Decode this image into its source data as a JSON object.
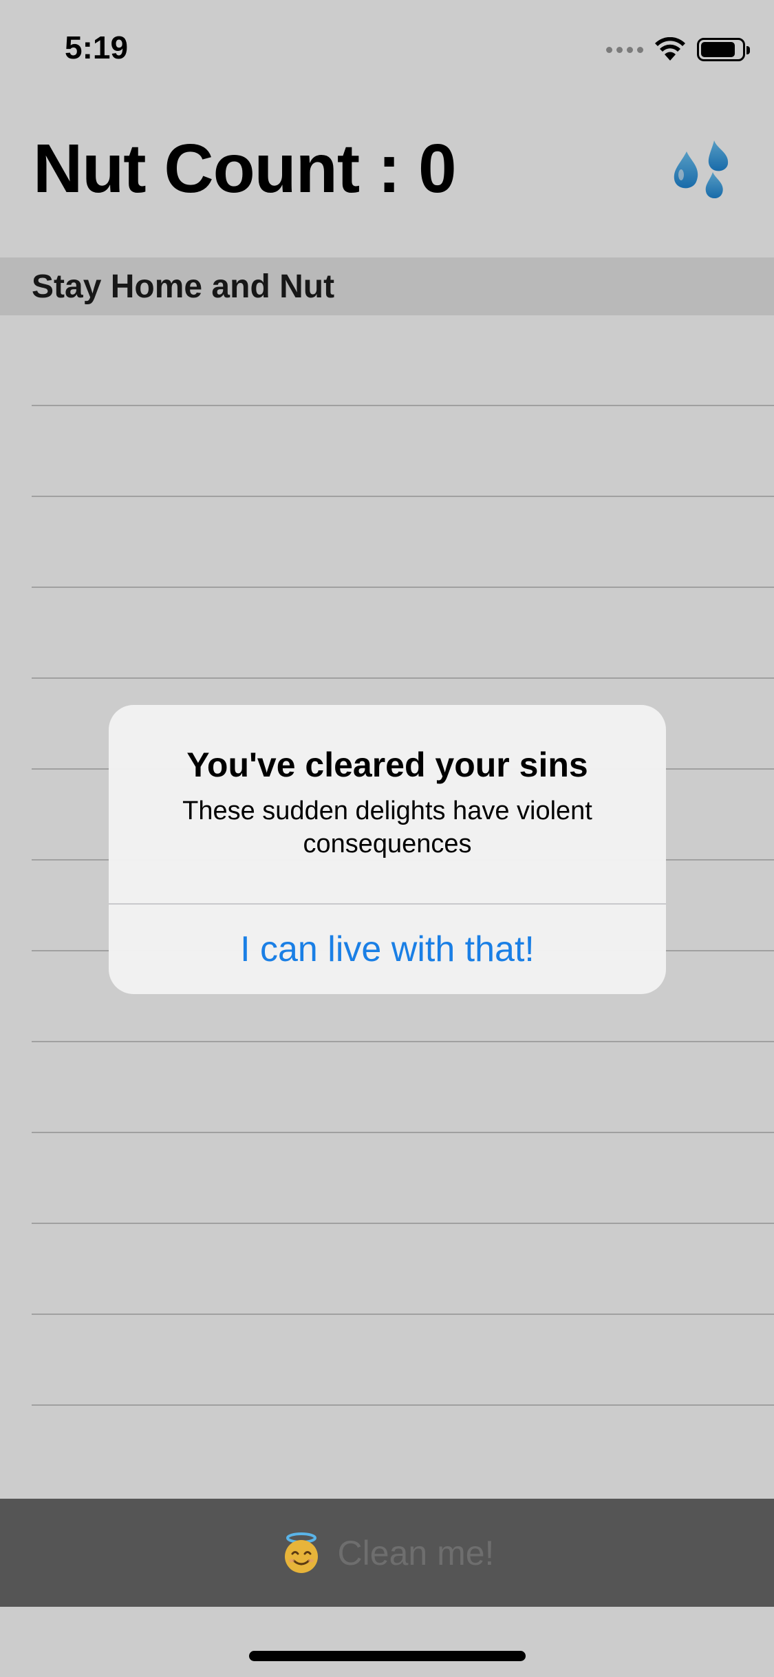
{
  "status": {
    "time": "5:19",
    "icons": [
      "signal-dots-icon",
      "wifi-icon",
      "battery-icon"
    ],
    "battery_level": 0.85
  },
  "nav": {
    "title": "Nut Count : 0",
    "action_icon": "sweat-droplets-icon"
  },
  "section": {
    "header": "Stay Home and Nut"
  },
  "list": {
    "rows": [
      "",
      "",
      "",
      "",
      "",
      "",
      "",
      "",
      "",
      "",
      "",
      ""
    ]
  },
  "bottom_bar": {
    "icon": "halo-face-icon",
    "label": "Clean me!"
  },
  "alert": {
    "title": "You've cleared your sins",
    "message": "These sudden delights have violent consequences",
    "button": "I can live with that!"
  },
  "colors": {
    "accent": "#1a7fe5",
    "droplet": "#2f9fe8",
    "bottom_bar": "#555555"
  }
}
